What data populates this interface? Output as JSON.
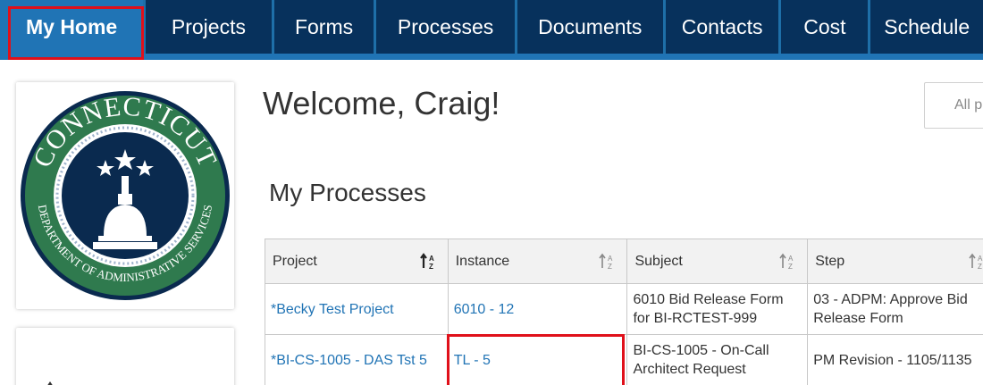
{
  "nav": {
    "tabs": [
      {
        "label": "My Home",
        "active": true
      },
      {
        "label": "Projects"
      },
      {
        "label": "Forms"
      },
      {
        "label": "Processes"
      },
      {
        "label": "Documents"
      },
      {
        "label": "Contacts"
      },
      {
        "label": "Cost"
      },
      {
        "label": "Schedule"
      }
    ]
  },
  "logo": {
    "top_text": "CONNECTICUT",
    "ring_text": "DEPARTMENT OF ADMINISTRATIVE SERVICES"
  },
  "welcome": "Welcome, Craig!",
  "filter": {
    "text": "All p"
  },
  "processes": {
    "title": "My Processes",
    "columns": [
      "Project",
      "Instance",
      "Subject",
      "Step"
    ],
    "rows": [
      {
        "project": "*Becky Test Project",
        "instance": "6010 - 12",
        "subject": "6010 Bid Release Form for BI-RCTEST-999",
        "step": "03 - ADPM: Approve Bid Release Form"
      },
      {
        "project": "*BI-CS-1005 - DAS Tst 5",
        "instance": "TL - 5",
        "subject": "BI-CS-1005 - On-Call Architect Request",
        "step": "PM Revision - 1105/1135"
      }
    ]
  },
  "colors": {
    "nav_dark": "#07315c",
    "nav_active": "#2074b5",
    "link": "#2174b5",
    "highlight": "#e0101a"
  }
}
